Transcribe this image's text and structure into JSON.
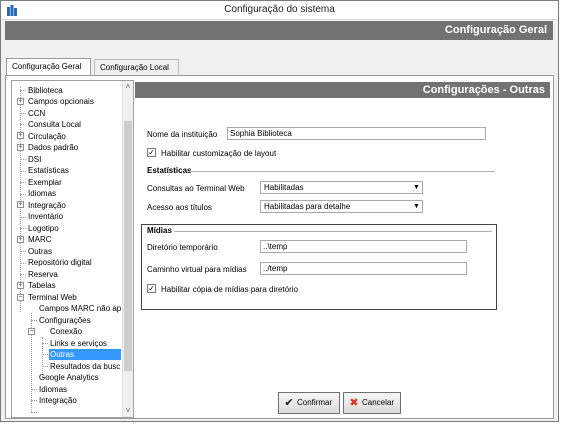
{
  "window": {
    "title": "Configuração do sistema"
  },
  "header": {
    "title": "Configuração Geral"
  },
  "tabs": [
    {
      "label": "Configuração Geral",
      "active": true
    },
    {
      "label": "Configuração Local",
      "active": false
    }
  ],
  "tree": {
    "items": [
      {
        "label": "Biblioteca"
      },
      {
        "label": "Campos opcionais"
      },
      {
        "label": "CCN"
      },
      {
        "label": "Consulta Local"
      },
      {
        "label": "Circulação"
      },
      {
        "label": "Dados padrão"
      },
      {
        "label": "DSI"
      },
      {
        "label": "Estatísticas"
      },
      {
        "label": "Exemplar"
      },
      {
        "label": "Idiomas"
      },
      {
        "label": "Integração"
      },
      {
        "label": "Inventário"
      },
      {
        "label": "Logotipo"
      },
      {
        "label": "MARC"
      },
      {
        "label": "Outras"
      },
      {
        "label": "Repositório digital"
      },
      {
        "label": "Reserva"
      },
      {
        "label": "Tabelas"
      },
      {
        "label": "Terminal Web"
      },
      {
        "label": "Campos MARC não ap"
      },
      {
        "label": "Configurações"
      },
      {
        "label": "Conexão"
      },
      {
        "label": "Links e serviços"
      },
      {
        "label": "Outras"
      },
      {
        "label": "Resultados da busc"
      },
      {
        "label": "Google Analytics"
      },
      {
        "label": "Idiomas"
      },
      {
        "label": "Integração"
      }
    ],
    "selected": "Outras"
  },
  "section": {
    "title": "Configurações - Outras"
  },
  "form": {
    "institution_label": "Nome da instituição",
    "institution_value": "Sophia Biblioteca",
    "customize_layout_label": "Habilitar customização de layout",
    "customize_layout_checked": true,
    "stats_heading": "Estatísticas",
    "web_queries_label": "Consultas ao Terminal Web",
    "web_queries_value": "Habilitadas",
    "titles_access_label": "Acesso aos títulos",
    "titles_access_value": "Habilitadas para detalhe",
    "media_heading": "Mídias",
    "temp_dir_label": "Diretório temporário",
    "temp_dir_value": "..\\temp",
    "virtual_path_label": "Caminho virtual para mídias",
    "virtual_path_value": "../temp",
    "copy_media_label": "Habilitar cópia de mídias para diretório",
    "copy_media_checked": true
  },
  "buttons": {
    "confirm": "Confirmar",
    "cancel": "Cancelar"
  },
  "colors": {
    "banner": "#727272",
    "selection": "#3399ff",
    "cancel_icon": "#d9342b",
    "confirm_icon": "#1a1a1a"
  }
}
